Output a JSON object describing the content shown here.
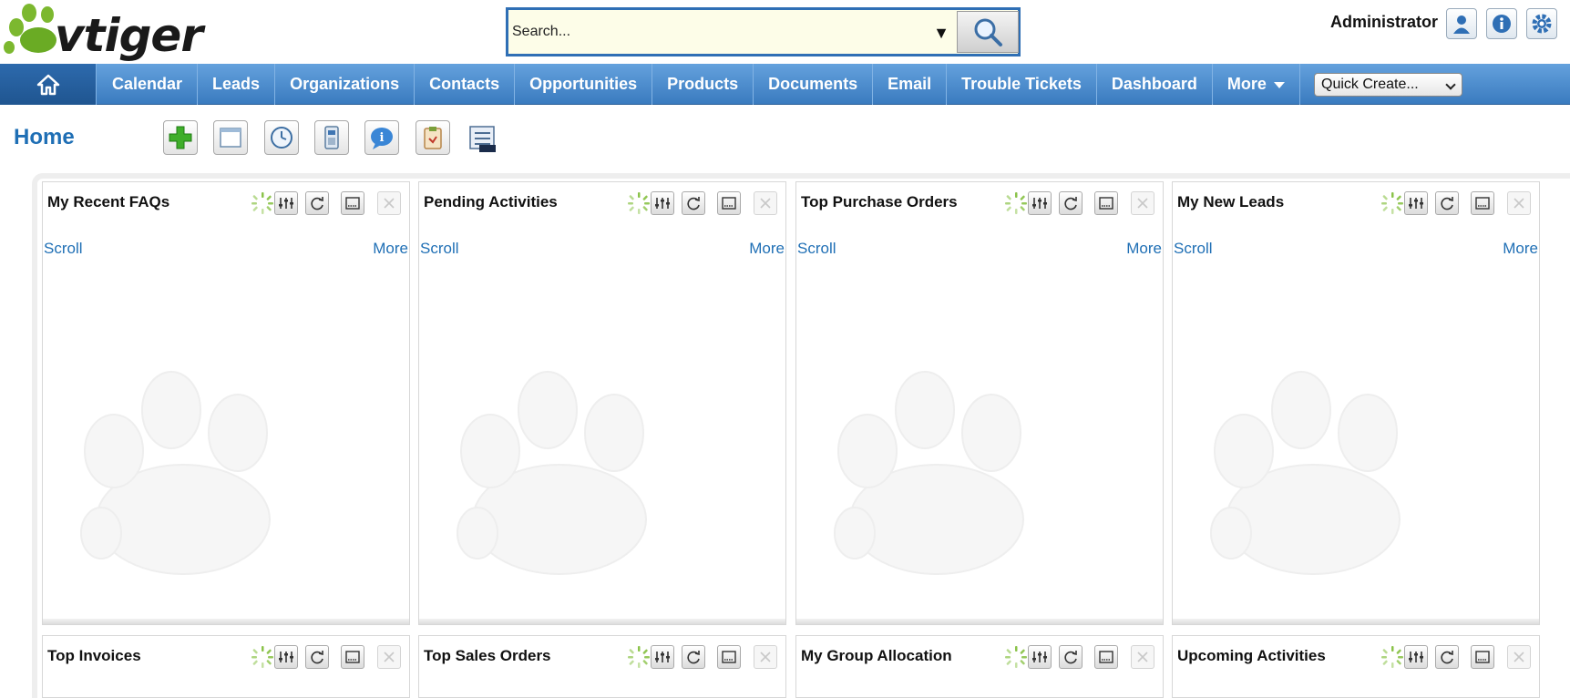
{
  "app": {
    "logo_text": "vtiger"
  },
  "search": {
    "placeholder": "Search..."
  },
  "user": {
    "name": "Administrator"
  },
  "nav": {
    "items": [
      {
        "label": "Calendar"
      },
      {
        "label": "Leads"
      },
      {
        "label": "Organizations"
      },
      {
        "label": "Contacts"
      },
      {
        "label": "Opportunities"
      },
      {
        "label": "Products"
      },
      {
        "label": "Documents"
      },
      {
        "label": "Email"
      },
      {
        "label": "Trouble Tickets"
      },
      {
        "label": "Dashboard"
      },
      {
        "label": "More"
      }
    ],
    "quick_create": "Quick Create..."
  },
  "page": {
    "title": "Home"
  },
  "widgets": [
    {
      "title": "My Recent FAQs",
      "scroll": "Scroll",
      "more": "More"
    },
    {
      "title": "Pending Activities",
      "scroll": "Scroll",
      "more": "More"
    },
    {
      "title": "Top Purchase Orders",
      "scroll": "Scroll",
      "more": "More"
    },
    {
      "title": "My New Leads",
      "scroll": "Scroll",
      "more": "More"
    },
    {
      "title": "Top Invoices"
    },
    {
      "title": "Top Sales Orders"
    },
    {
      "title": "My Group Allocation"
    },
    {
      "title": "Upcoming Activities"
    }
  ],
  "colors": {
    "nav_bg": "#4a8ccf",
    "link": "#1f6fb5",
    "logo_green": "#7cb82f"
  }
}
